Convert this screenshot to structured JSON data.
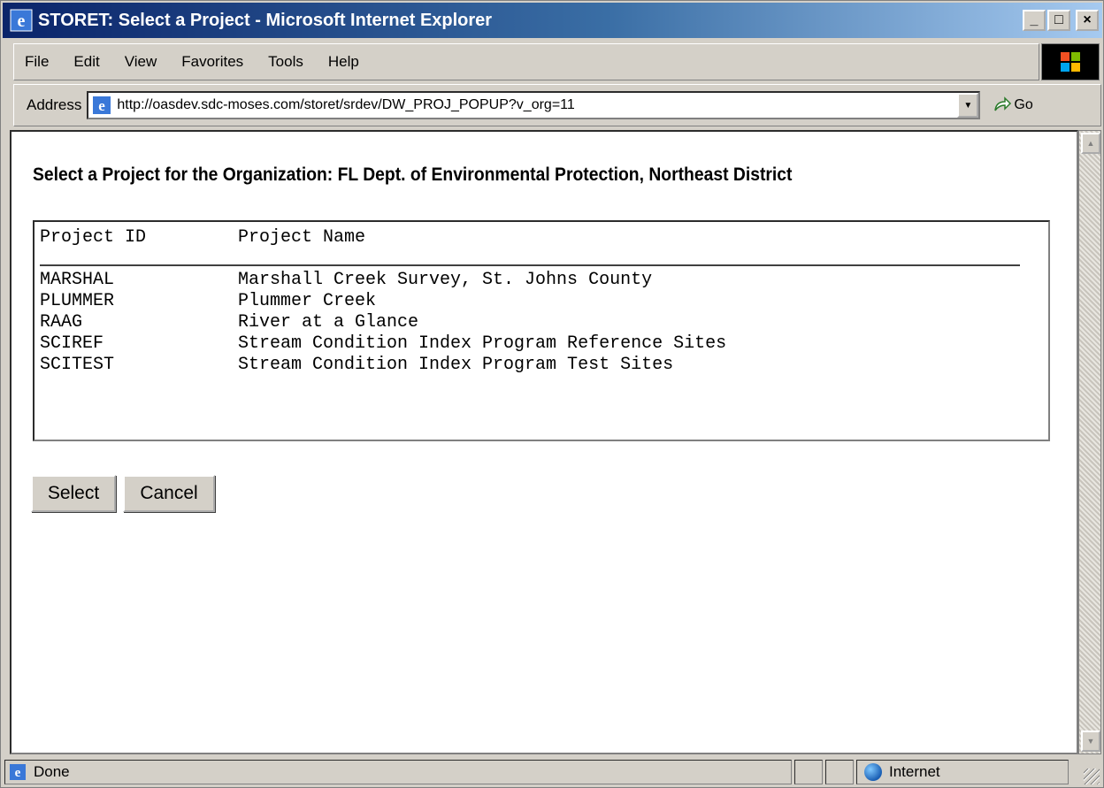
{
  "window": {
    "title": "STORET: Select a Project - Microsoft Internet Explorer",
    "minimize": "_",
    "maximize": "□",
    "close": "×"
  },
  "menu": [
    "File",
    "Edit",
    "View",
    "Favorites",
    "Tools",
    "Help"
  ],
  "address": {
    "label": "Address",
    "url": "http://oasdev.sdc-moses.com/storet/srdev/DW_PROJ_POPUP?v_org=11",
    "go_label": "Go"
  },
  "page": {
    "heading": "Select a Project for the Organization: FL Dept. of Environmental Protection, Northeast District",
    "list": {
      "columns": [
        "Project ID",
        "Project Name"
      ],
      "rows": [
        [
          "MARSHAL",
          "Marshall Creek Survey, St. Johns County"
        ],
        [
          "PLUMMER",
          "Plummer Creek"
        ],
        [
          "RAAG",
          "River at a Glance"
        ],
        [
          "SCIREF",
          "Stream Condition Index Program Reference Sites"
        ],
        [
          "SCITEST",
          "Stream Condition Index Program Test Sites"
        ]
      ]
    },
    "buttons": {
      "select": "Select",
      "cancel": "Cancel"
    }
  },
  "status": {
    "text": "Done",
    "zone": "Internet"
  },
  "colors": {
    "titlebar_start": "#0a246a",
    "titlebar_end": "#a6caf0",
    "chrome": "#d4d0c8"
  },
  "icons": [
    "ie-icon",
    "windows-logo-icon",
    "go-arrow-icon",
    "globe-icon",
    "dropdown-arrow-icon"
  ]
}
